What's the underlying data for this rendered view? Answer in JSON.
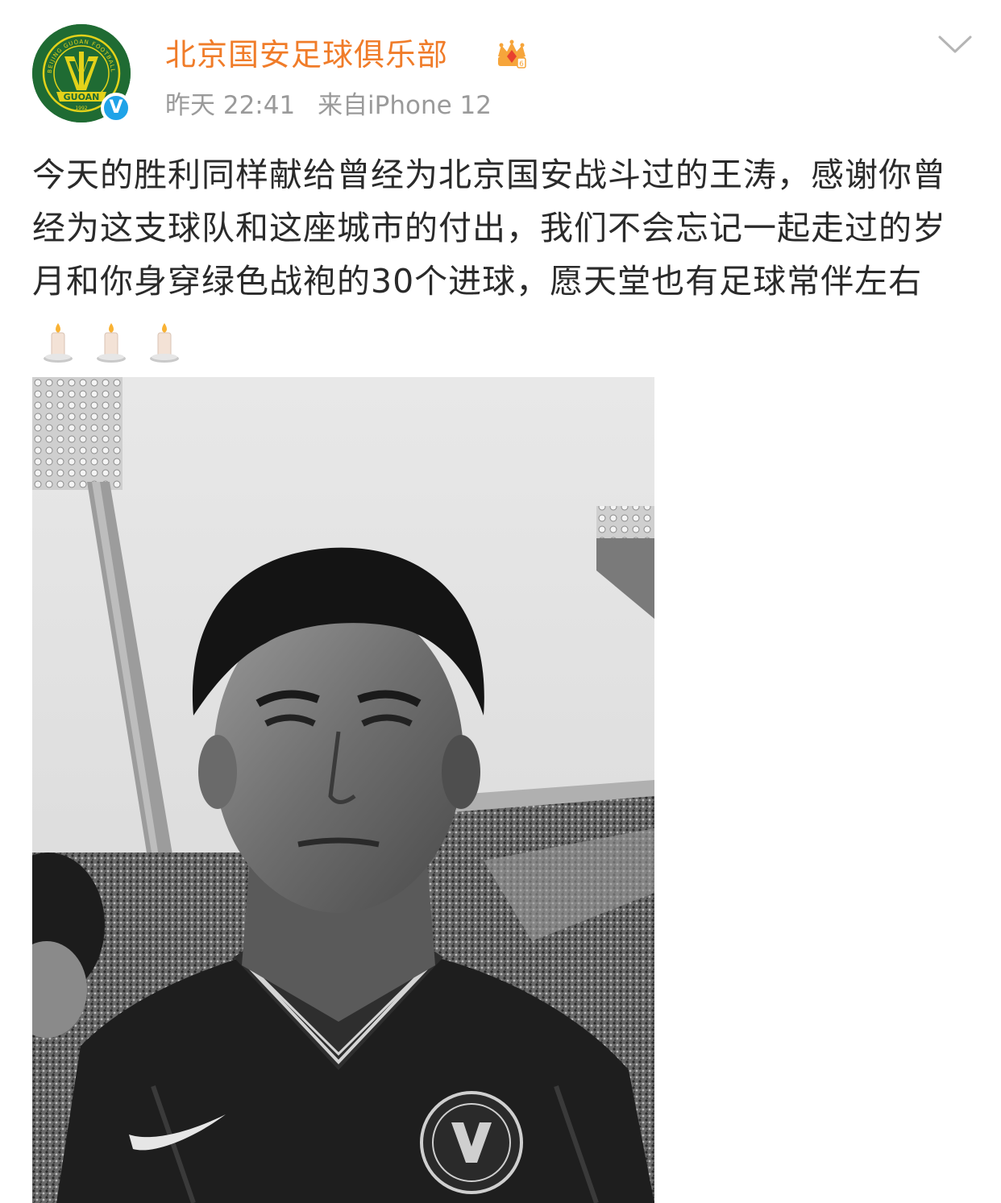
{
  "post": {
    "username": "北京国安足球俱乐部",
    "timestamp": "昨天 22:41",
    "source": "来自iPhone 12",
    "content_text": "今天的胜利同样献给曾经为北京国安战斗过的王涛，感谢你曾经为这支球队和这座城市的付出，我们不会忘记一起走过的岁月和你身穿绿色战袍的30个进球，愿天堂也有足球常伴左右",
    "emoji": [
      "candle-emoji",
      "candle-emoji",
      "candle-emoji"
    ],
    "avatar": {
      "logo_text": "GUOAN",
      "logo_year": "1992",
      "logo_ring_text": "BEIJING GUOAN FOOTBALL CLUB",
      "verified_mark": "V"
    },
    "photo": {
      "subject": "black-and-white photo of a footballer in a stadium"
    }
  },
  "icons": {
    "vip": "vip-crown-badge-icon",
    "verified": "verified-v-icon",
    "menu": "chevron-down-icon"
  },
  "colors": {
    "username": "#f07c29",
    "meta": "#9a9a9a",
    "text": "#2a2a2a",
    "avatar_bg": "#1f6b33",
    "logo_yellow": "#e3d21a",
    "verified": "#1fa3e8"
  }
}
